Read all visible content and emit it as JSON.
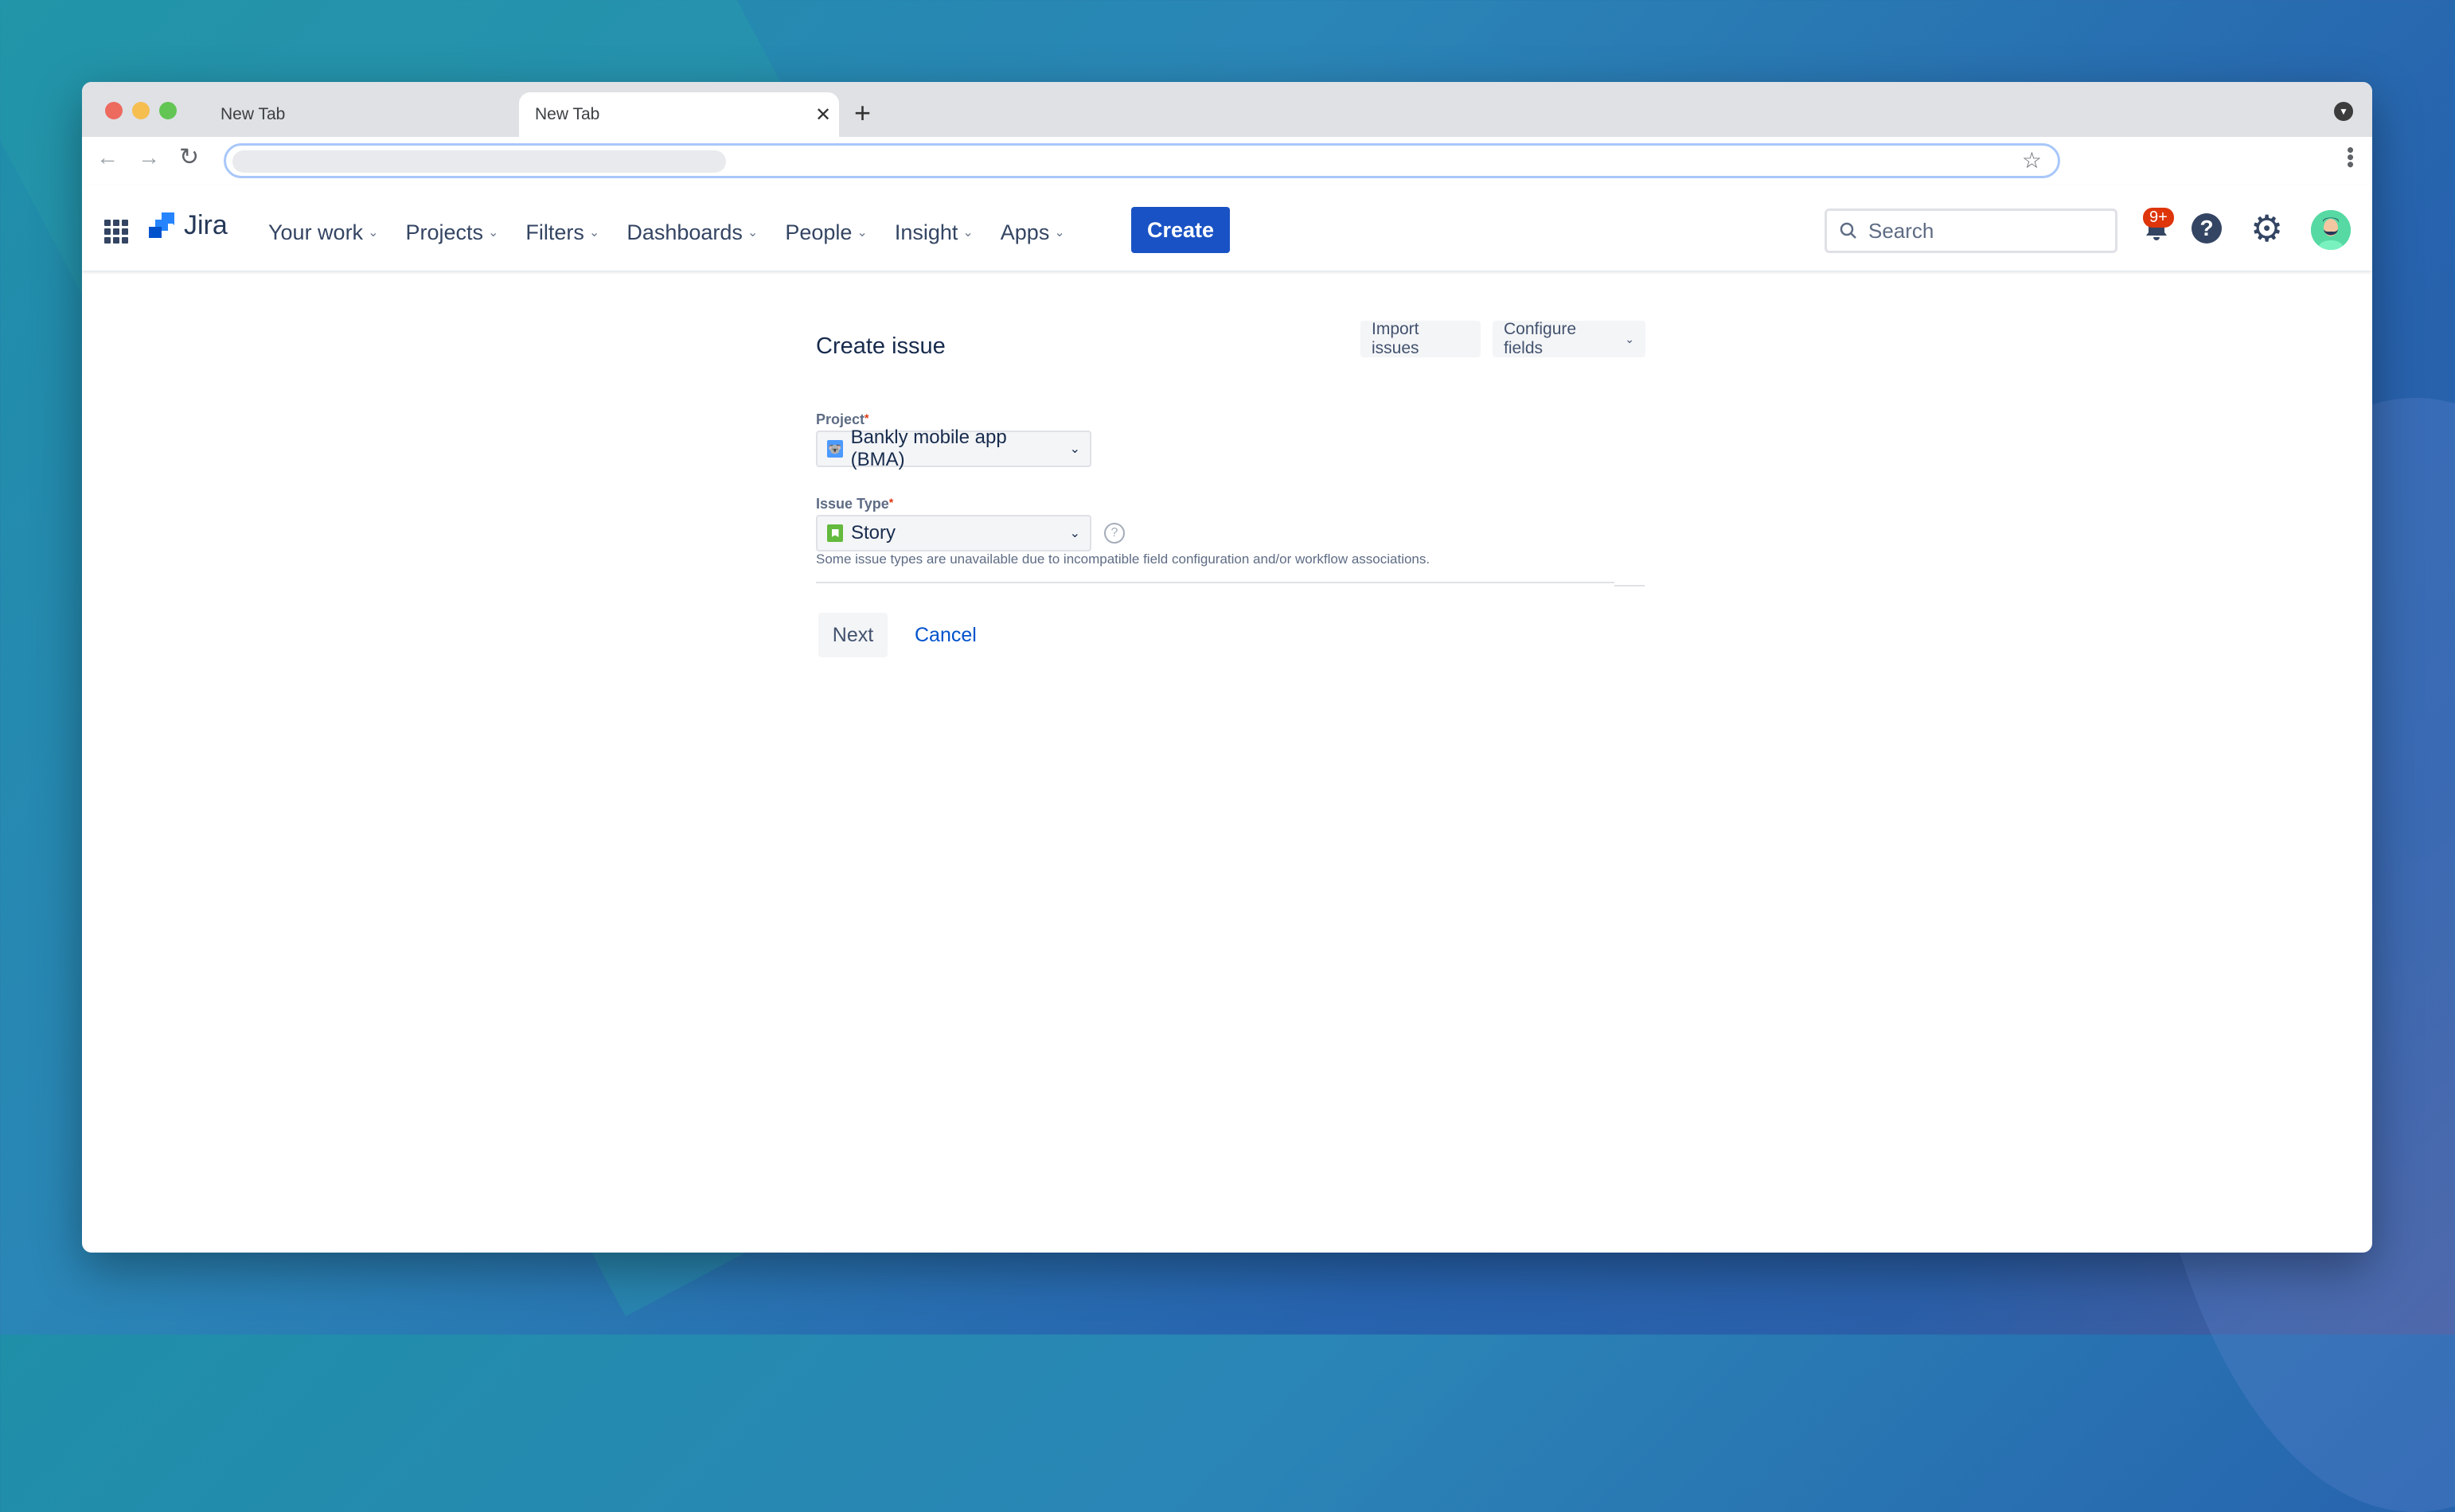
{
  "browser": {
    "tabs": [
      {
        "title": "New Tab",
        "active": false
      },
      {
        "title": "New Tab",
        "active": true
      }
    ],
    "new_tab_icon": "plus-icon",
    "address": ""
  },
  "header": {
    "logo_text": "Jira",
    "nav": [
      {
        "label": "Your work"
      },
      {
        "label": "Projects"
      },
      {
        "label": "Filters"
      },
      {
        "label": "Dashboards"
      },
      {
        "label": "People"
      },
      {
        "label": "Insight"
      },
      {
        "label": "Apps"
      }
    ],
    "create_label": "Create",
    "search_placeholder": "Search",
    "notifications_badge": "9+",
    "colors": {
      "primary": "#1952c4",
      "badge": "#de350b",
      "text": "#344563"
    }
  },
  "form": {
    "title": "Create issue",
    "import_label": "Import issues",
    "configure_label": "Configure fields",
    "project_label": "Project",
    "project_value": "Bankly mobile app (BMA)",
    "issue_type_label": "Issue Type",
    "issue_type_value": "Story",
    "required_mark": "*",
    "hint": "Some issue types are unavailable due to incompatible field configuration and/or workflow associations.",
    "next_label": "Next",
    "cancel_label": "Cancel"
  }
}
